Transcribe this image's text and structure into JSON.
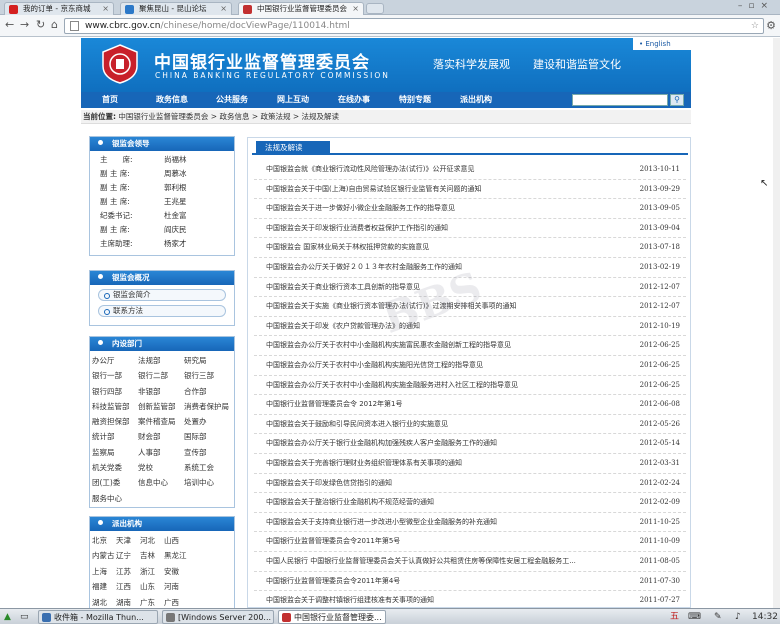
{
  "browser": {
    "tabs": [
      {
        "label": "我的订单 - 京东商城",
        "fav": "#d42020"
      },
      {
        "label": "聚焦昆山 - 昆山论坛",
        "fav": "#2b78c8"
      },
      {
        "label": "中国银行业监督管理委员会",
        "fav": "#c23030"
      }
    ],
    "url_host": "www.cbrc.gov.cn",
    "url_path": "/chinese/home/docViewPage/110014.html"
  },
  "header": {
    "title": "中国银行业监督管理委员会",
    "subtitle_en": "CHINA BANKING REGULATORY COMMISSION",
    "slogan1": "落实科学发展观",
    "slogan2": "建设和谐监管文化",
    "english_link": "• English"
  },
  "menu": [
    "首页",
    "政务信息",
    "公共服务",
    "网上互动",
    "在线办事",
    "特别专题",
    "派出机构"
  ],
  "breadcrumb": {
    "label": "当前位置:",
    "path": "中国银行业监督管理委员会 > 政务信息 > 政策法规 > 法规及解读"
  },
  "leaders": {
    "title": "银监会领导",
    "rows": [
      {
        "role": "主　　席:",
        "name": "尚福林"
      },
      {
        "role": "副 主 席:",
        "name": "周慕冰"
      },
      {
        "role": "副 主 席:",
        "name": "郭利根"
      },
      {
        "role": "副 主 席:",
        "name": "王兆星"
      },
      {
        "role": "纪委书记:",
        "name": "杜金富"
      },
      {
        "role": "副 主 席:",
        "name": "阎庆民"
      },
      {
        "role": "主席助理:",
        "name": "杨家才"
      }
    ]
  },
  "overview": {
    "title": "银监会概况",
    "buttons": [
      "银监会简介",
      "联系方法"
    ]
  },
  "departments": {
    "title": "内设部门",
    "items": [
      "办公厅",
      "法规部",
      "研究局",
      "银行一部",
      "银行二部",
      "银行三部",
      "银行四部",
      "非银部",
      "合作部",
      "科技监管部",
      "创新监管部",
      "消费者保护局",
      "融资担保部",
      "案件稽查局",
      "处置办",
      "统计部",
      "财会部",
      "国际部",
      "监察局",
      "人事部",
      "宣传部",
      "机关党委",
      "党校",
      "系统工会",
      "团(工)委",
      "信息中心",
      "培训中心",
      "服务中心"
    ]
  },
  "branches": {
    "title": "派出机构",
    "items": [
      "北京",
      "天津",
      "河北",
      "山西",
      "内蒙古",
      "辽宁",
      "吉林",
      "黑龙江",
      "上海",
      "江苏",
      "浙江",
      "安徽",
      "福建",
      "江西",
      "山东",
      "河南",
      "湖北",
      "湖南",
      "广东",
      "广西"
    ]
  },
  "content": {
    "tab": "法规及解读",
    "items": [
      {
        "title": "中国银监会就《商业银行流动性风险管理办法(试行)》公开征求意见",
        "date": "2013-10-11"
      },
      {
        "title": "中国银监会关于中国(上海)自由贸易试验区银行业监管有关问题的通知",
        "date": "2013-09-29"
      },
      {
        "title": "中国银监会关于进一步做好小微企业金融服务工作的指导意见",
        "date": "2013-09-05"
      },
      {
        "title": "中国银监会关于印发银行业消费者权益保护工作指引的通知",
        "date": "2013-09-04"
      },
      {
        "title": "中国银监会 国家林业局关于林权抵押贷款的实施意见",
        "date": "2013-07-18"
      },
      {
        "title": "中国银监会办公厅关于做好２０１３年农村金融服务工作的通知",
        "date": "2013-02-19"
      },
      {
        "title": "中国银监会关于商业银行资本工具创新的指导意见",
        "date": "2012-12-07"
      },
      {
        "title": "中国银监会关于实施《商业银行资本管理办法(试行)》过渡期安排相关事项的通知",
        "date": "2012-12-07"
      },
      {
        "title": "中国银监会关于印发《农户贷款管理办法》的通知",
        "date": "2012-10-19"
      },
      {
        "title": "中国银监会办公厅关于农村中小金融机构实施富民惠农金融创新工程的指导意见",
        "date": "2012-06-25"
      },
      {
        "title": "中国银监会办公厅关于农村中小金融机构实施阳光信贷工程的指导意见",
        "date": "2012-06-25"
      },
      {
        "title": "中国银监会办公厅关于农村中小金融机构实施金融服务进村入社区工程的指导意见",
        "date": "2012-06-25"
      },
      {
        "title": "中国银行业监督管理委员会令 2012年第1号",
        "date": "2012-06-08"
      },
      {
        "title": "中国银监会关于鼓励和引导民间资本进入银行业的实施意见",
        "date": "2012-05-26"
      },
      {
        "title": "中国银监会办公厅关于银行业金融机构加强残疾人客户金融服务工作的通知",
        "date": "2012-05-14"
      },
      {
        "title": "中国银监会关于完善银行理财业务组织管理体系有关事项的通知",
        "date": "2012-03-31"
      },
      {
        "title": "中国银监会关于印发绿色信贷指引的通知",
        "date": "2012-02-24"
      },
      {
        "title": "中国银监会关于整治银行业金融机构不规范经营的通知",
        "date": "2012-02-09"
      },
      {
        "title": "中国银监会关于支持商业银行进一步改进小型微型企业金融服务的补充通知",
        "date": "2011-10-25"
      },
      {
        "title": "中国银行业监督管理委员会令2011年第5号",
        "date": "2011-10-09"
      },
      {
        "title": "中国人民银行 中国银行业监督管理委员会关于认真做好公共租赁住房等保障性安居工程金融服务工...",
        "date": "2011-08-05"
      },
      {
        "title": "中国银行业监督管理委员会令2011年第4号",
        "date": "2011-07-30"
      },
      {
        "title": "中国银监会关于调整村镇银行组建核准有关事项的通知",
        "date": "2011-07-27"
      }
    ]
  },
  "taskbar": {
    "items": [
      {
        "label": "收件箱 - Mozilla Thun...",
        "color": "#3a6fb0"
      },
      {
        "label": "[Windows Server 200...",
        "color": "#777"
      },
      {
        "label": "中国银行业监督管理委...",
        "color": "#c23030"
      }
    ],
    "clock": "14:32"
  }
}
